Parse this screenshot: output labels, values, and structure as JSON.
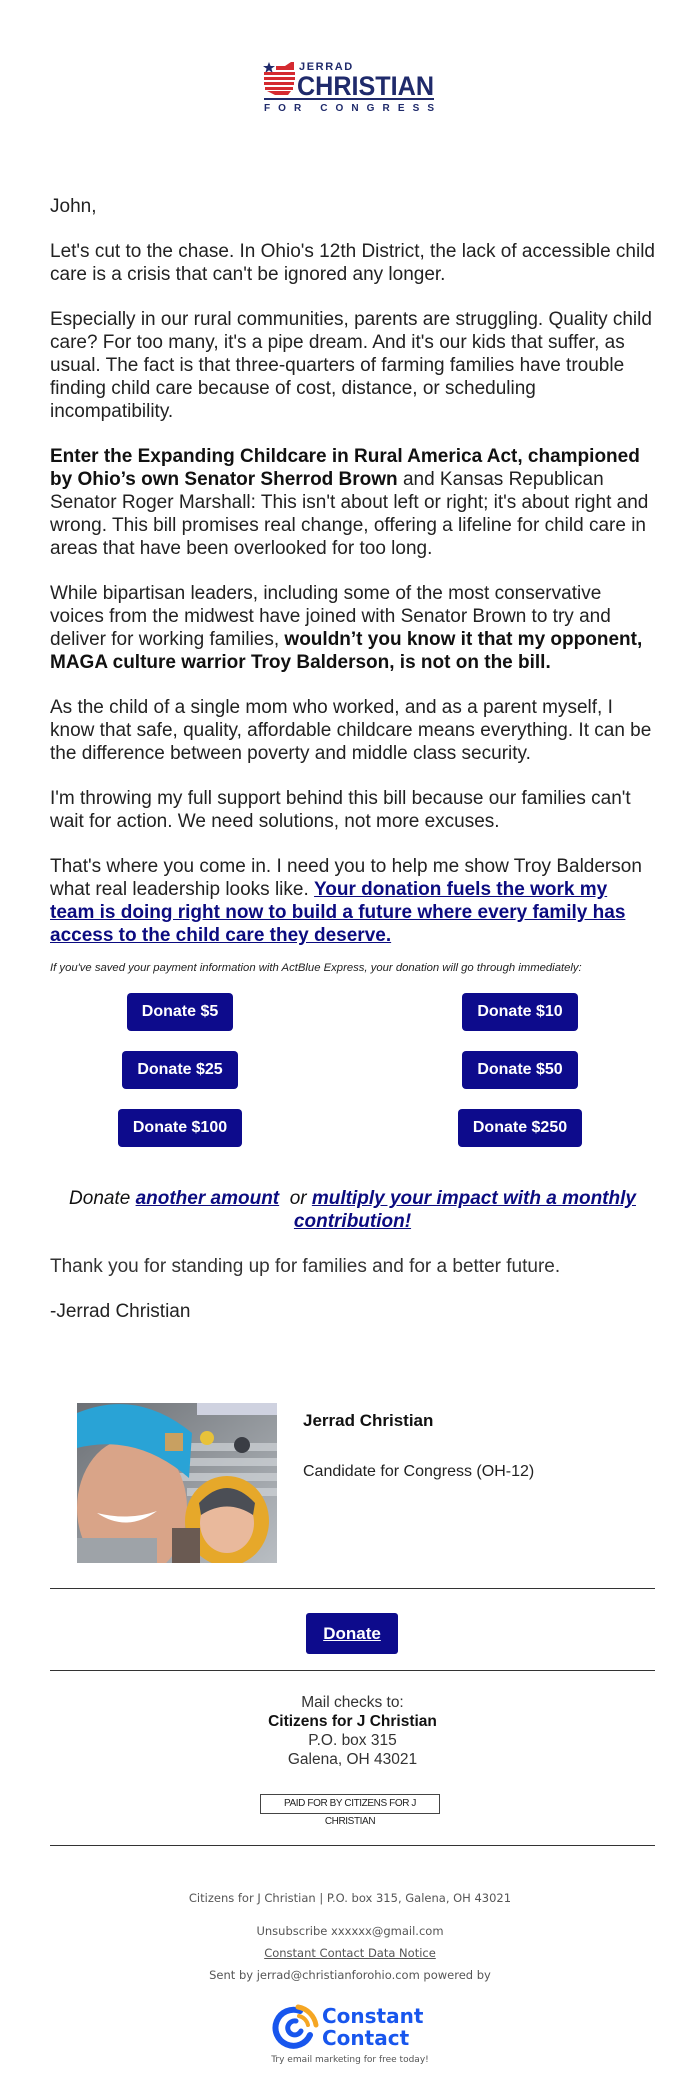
{
  "header": {
    "logo": {
      "line1": "JERRAD",
      "line2": "CHRISTIAN",
      "line3": "FOR CONGRESS",
      "colors": {
        "navy": "#1f2a6b",
        "red": "#d42a30"
      }
    }
  },
  "email": {
    "greeting": "John,",
    "p1": "Let's cut to the chase. In Ohio's 12th District, the lack of accessible child care is a crisis that can't be ignored any longer.",
    "p2": "Especially in our rural communities, parents are struggling. Quality child care? For too many, it's a pipe dream. And it's our kids that suffer, as usual. The fact is that three-quarters of farming families have trouble finding child care because of cost, distance, or scheduling incompatibility.",
    "p3_bold": "Enter the Expanding Childcare in Rural America Act, championed by Ohio’s own Senator Sherrod Brown",
    "p3_rest": " and Kansas Republican Senator Roger Marshall: This isn't about left or right; it's about right and wrong. This bill promises real change, offering a lifeline for child care in areas that have been overlooked for too long.",
    "p4_start": "While bipartisan leaders, including some of the most conservative voices from the midwest have joined with Senator Brown to try and deliver for working families, ",
    "p4_bold": "wouldn’t you know it that my opponent, MAGA culture warrior Troy Balderson, is not on the bill.",
    "p5": "As the child of a single mom who worked, and as a parent myself, I know that safe, quality, affordable childcare means everything. It can be the difference between poverty and middle class security.",
    "p6": "I'm throwing my full support behind this bill because our families can't wait for action. We need solutions, not more excuses.",
    "p7_start": "That's where you come in. I need you to help me show Troy Balderson what real leadership looks like. ",
    "p7_link": "Your donation fuels the work my team is doing right now to build a future where every family has access to the child care they deserve.",
    "express_note": "If you've saved your payment information with ActBlue Express, your donation will go through immediately:",
    "donate_buttons": [
      {
        "label": "Donate $5",
        "amount": 5
      },
      {
        "label": "Donate $10",
        "amount": 10
      },
      {
        "label": "Donate $25",
        "amount": 25
      },
      {
        "label": "Donate $50",
        "amount": 50
      },
      {
        "label": "Donate $100",
        "amount": 100
      },
      {
        "label": "Donate $250",
        "amount": 250
      }
    ],
    "alt_prefix": "Donate ",
    "alt_link1": "another amount",
    "alt_middle": "  or ",
    "alt_link2": "multiply your impact with a monthly contribution!",
    "thanks": "Thank you for standing up for families and for a better future.",
    "signoff": "-Jerrad Christian"
  },
  "signature": {
    "name": "Jerrad Christian",
    "title": "Candidate for Congress (OH-12)"
  },
  "cta": {
    "donate_label": "Donate"
  },
  "mail": {
    "label": "Mail checks to:",
    "org": "Citizens for J Christian",
    "address1": "P.O. box 315",
    "address2": "Galena, OH 43021"
  },
  "paid_for": "PAID FOR BY CITIZENS FOR J CHRISTIAN",
  "footer": {
    "address_line": "Citizens for J Christian | P.O. box 315, Galena, OH 43021",
    "unsubscribe_label": "Unsubscribe",
    "unsubscribe_email": "xxxxxx@gmail.com",
    "data_notice": "Constant Contact Data Notice",
    "sent_by": "Sent by jerrad@christianforohio.com powered by",
    "cc_logo_line1": "Constant",
    "cc_logo_line2": "Contact",
    "cc_tagline": "Try email marketing for free today!"
  },
  "colors": {
    "button": "#0d0b8c",
    "link": "#0b0b80",
    "cc_blue": "#1856ed",
    "cc_orange": "#f5a623"
  }
}
